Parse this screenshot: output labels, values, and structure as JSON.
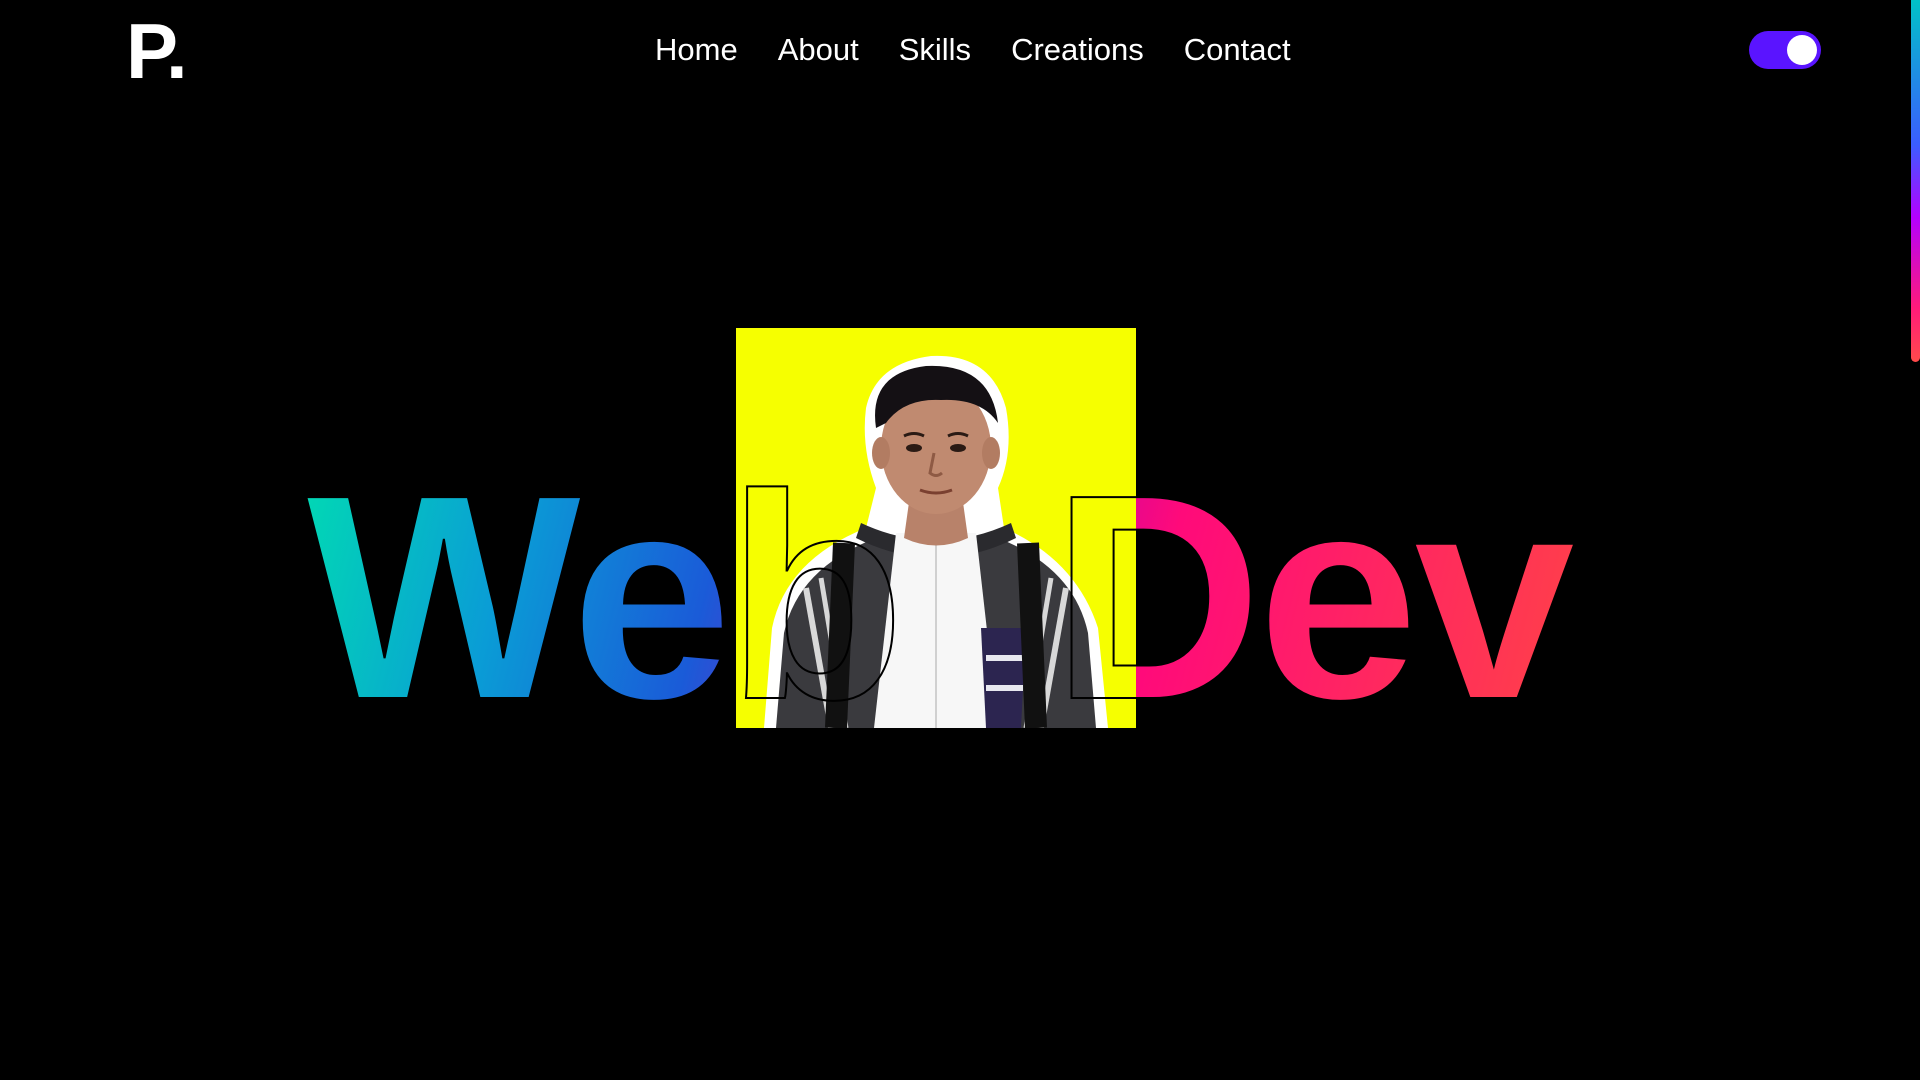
{
  "header": {
    "logo": "P."
  },
  "nav": {
    "items": [
      "Home",
      "About",
      "Skills",
      "Creations",
      "Contact"
    ]
  },
  "theme_toggle": {
    "state": "on",
    "color": "#5a14ff"
  },
  "hero": {
    "title_left": "Web",
    "title_right": "Dev",
    "photo_background": "#f6ff00",
    "gradient": [
      "#00e0b0",
      "#0a9cd6",
      "#1a5bd8",
      "#b000b8",
      "#ff0a7a",
      "#ff4545"
    ]
  }
}
